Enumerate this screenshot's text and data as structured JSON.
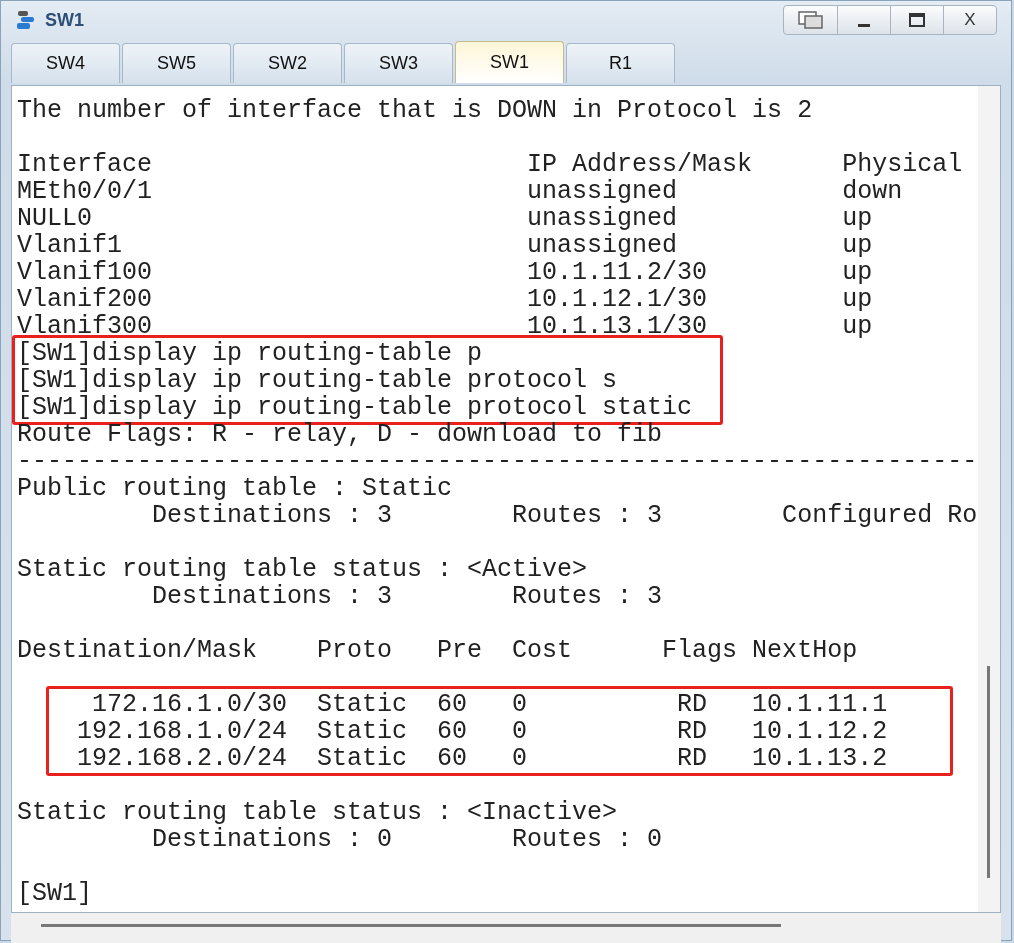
{
  "window": {
    "title": "SW1",
    "close_label": "X"
  },
  "tabs": [
    {
      "label": "SW4",
      "selected": false
    },
    {
      "label": "SW5",
      "selected": false
    },
    {
      "label": "SW2",
      "selected": false
    },
    {
      "label": "SW3",
      "selected": false
    },
    {
      "label": "SW1",
      "selected": true
    },
    {
      "label": "R1",
      "selected": false
    }
  ],
  "terminal": {
    "blocks": [
      {
        "kind": "text",
        "blank_before": false,
        "lines": [
          "The number of interface that is DOWN in Protocol is 2"
        ]
      },
      {
        "kind": "text",
        "blank_before": true,
        "lines": [
          "Interface                         IP Address/Mask      Physical",
          "MEth0/0/1                         unassigned           down",
          "NULL0                             unassigned           up",
          "Vlanif1                           unassigned           up",
          "Vlanif100                         10.1.11.2/30         up",
          "Vlanif200                         10.1.12.1/30         up",
          "Vlanif300                         10.1.13.1/30         up"
        ]
      },
      {
        "kind": "highlight",
        "blank_before": false,
        "lines": [
          "[SW1]display ip routing-table p",
          "[SW1]display ip routing-table protocol s",
          "[SW1]display ip routing-table protocol static"
        ]
      },
      {
        "kind": "text",
        "blank_before": false,
        "lines": [
          "Route Flags: R - relay, D - download to fib",
          "----------------------------------------------------------------",
          "Public routing table : Static",
          "         Destinations : 3        Routes : 3        Configured Ro"
        ]
      },
      {
        "kind": "text",
        "blank_before": true,
        "lines": [
          "Static routing table status : <Active>",
          "         Destinations : 3        Routes : 3"
        ]
      },
      {
        "kind": "text",
        "blank_before": true,
        "lines": [
          "Destination/Mask    Proto   Pre  Cost      Flags NextHop"
        ]
      },
      {
        "kind": "highlight",
        "blank_before": true,
        "lines": [
          "     172.16.1.0/30  Static  60   0          RD   10.1.11.1",
          "    192.168.1.0/24  Static  60   0          RD   10.1.12.2",
          "    192.168.2.0/24  Static  60   0          RD   10.1.13.2"
        ]
      },
      {
        "kind": "text",
        "blank_before": true,
        "lines": [
          "Static routing table status : <Inactive>",
          "         Destinations : 0        Routes : 0"
        ]
      },
      {
        "kind": "text",
        "blank_before": true,
        "lines": [
          "[SW1]"
        ]
      }
    ]
  }
}
